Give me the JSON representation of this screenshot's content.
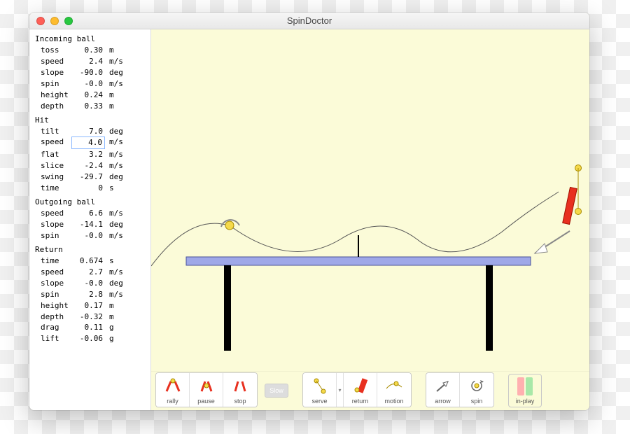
{
  "window": {
    "title": "SpinDoctor"
  },
  "sections": {
    "incoming": {
      "title": "Incoming ball",
      "rows": [
        {
          "label": "toss",
          "value": "0.30",
          "unit": "m"
        },
        {
          "label": "speed",
          "value": "2.4",
          "unit": "m/s"
        },
        {
          "label": "slope",
          "value": "-90.0",
          "unit": "deg"
        },
        {
          "label": "spin",
          "value": "-0.0",
          "unit": "m/s"
        },
        {
          "label": "height",
          "value": "0.24",
          "unit": "m"
        },
        {
          "label": "depth",
          "value": "0.33",
          "unit": "m"
        }
      ]
    },
    "hit": {
      "title": "Hit",
      "rows": [
        {
          "label": "tilt",
          "value": "7.0",
          "unit": "deg"
        },
        {
          "label": "speed",
          "value": "4.0",
          "unit": "m/s",
          "highlight": true
        },
        {
          "label": "flat",
          "value": "3.2",
          "unit": "m/s"
        },
        {
          "label": "slice",
          "value": "-2.4",
          "unit": "m/s"
        },
        {
          "label": "swing",
          "value": "-29.7",
          "unit": "deg"
        },
        {
          "label": "time",
          "value": "0",
          "unit": "s"
        }
      ]
    },
    "outgoing": {
      "title": "Outgoing ball",
      "rows": [
        {
          "label": "speed",
          "value": "6.6",
          "unit": "m/s"
        },
        {
          "label": "slope",
          "value": "-14.1",
          "unit": "deg"
        },
        {
          "label": "spin",
          "value": "-0.0",
          "unit": "m/s"
        }
      ]
    },
    "return": {
      "title": "Return",
      "rows": [
        {
          "label": "time",
          "value": "0.674",
          "unit": "s"
        },
        {
          "label": "speed",
          "value": "2.7",
          "unit": "m/s"
        },
        {
          "label": "slope",
          "value": "-0.0",
          "unit": "deg"
        },
        {
          "label": "spin",
          "value": "2.8",
          "unit": "m/s"
        },
        {
          "label": "height",
          "value": "0.17",
          "unit": "m"
        },
        {
          "label": "depth",
          "value": "-0.32",
          "unit": "m"
        },
        {
          "label": "drag",
          "value": "0.11",
          "unit": "g"
        },
        {
          "label": "lift",
          "value": "-0.06",
          "unit": "g"
        }
      ]
    }
  },
  "toolbar": {
    "group1": [
      "rally",
      "pause",
      "stop"
    ],
    "slow": "Slow",
    "group2": [
      "serve",
      "return",
      "motion"
    ],
    "group3": [
      "arrow",
      "spin"
    ],
    "inplay": "in-play"
  }
}
